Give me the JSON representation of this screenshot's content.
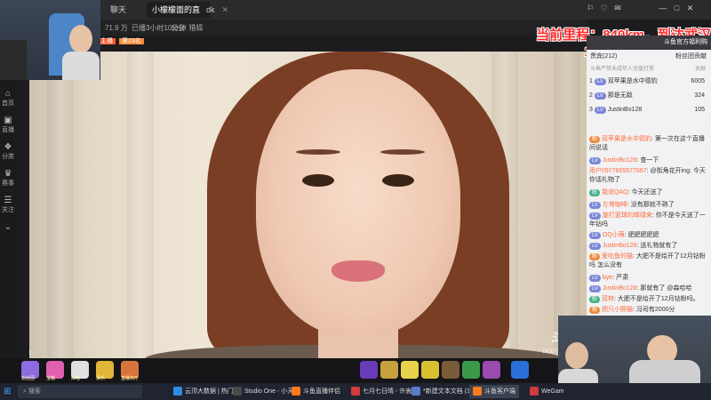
{
  "tabs": [
    {
      "label": "聊天"
    },
    {
      "label": "小檬檬面的直播间"
    },
    {
      "label": "dk"
    }
  ],
  "info": {
    "followers": "71.9 万",
    "duration": "已播3小时10分钟",
    "notice": "公会: 猎狐",
    "rank": "第23名",
    "tag": "主播"
  },
  "sidebar": [
    {
      "icon": "⌂",
      "label": "首页"
    },
    {
      "icon": "▣",
      "label": "直播"
    },
    {
      "icon": "❖",
      "label": "分类"
    },
    {
      "icon": "♛",
      "label": "赛事"
    },
    {
      "icon": "☰",
      "label": "关注"
    }
  ],
  "overlay": {
    "line1": "当前里程：840km，到达武汉",
    "line2": "10、11日双倍肥享值!"
  },
  "chat": {
    "header": "斗鱼官方福利购",
    "tab_label": "贵宾(212)",
    "tab_right": "粉丝团贡献",
    "subheader": "斗鱼严禁未成年人充值打赏",
    "rank_col": "贡献",
    "rank": [
      {
        "n": "1",
        "name": "双苹果是水中德豹",
        "val": "6005"
      },
      {
        "n": "2",
        "name": "那是无敌",
        "val": "324"
      },
      {
        "n": "3",
        "name": "JustinBo128",
        "val": "105"
      }
    ],
    "messages": [
      {
        "user": "双苹果是水中德豹",
        "text": "第一次在这个直播间说话"
      },
      {
        "user": "JustinBo128",
        "text": "查一下"
      },
      {
        "user": "用户0977855577667",
        "text": "@街角花开ing: 今天你话礼物了"
      },
      {
        "user": "我说QAQ",
        "text": "今天还送了"
      },
      {
        "user": "左塔咖啡",
        "text": "没有那就不熟了"
      },
      {
        "user": "旋打篮球的邮绿来",
        "text": "你不是今天送了一年钻吗"
      },
      {
        "user": "OQ小萌",
        "text": "肥肥肥肥肥"
      },
      {
        "user": "JustinBo128",
        "text": "送礼物就有了"
      },
      {
        "user": "爱吃鱼的猫",
        "text": "大肥不是给开了12月钻粉吗 怎么没有"
      },
      {
        "user": "bye",
        "text": "严肃"
      },
      {
        "user": "JustinBo128",
        "text": "那就有了 @森哈哈"
      },
      {
        "user": "双林",
        "text": "大肥不是给开了12月钻粉吗。"
      },
      {
        "user": "把只小野猫",
        "text": "冯司有2000分"
      }
    ]
  },
  "gifts": [
    {
      "label": "粉丝团"
    },
    {
      "label": "宝箱"
    },
    {
      "label": "红包"
    },
    {
      "label": "娱乐"
    },
    {
      "label": "直播天厅"
    }
  ],
  "video": {
    "watermark": "斗鱼",
    "watermark_sub": "DOUYU.COM",
    "corner_label": "斗鱼"
  },
  "taskbar": {
    "search": "搜索",
    "items": [
      {
        "label": "云顶大数据 | 热门...",
        "color": "#2f8de4"
      },
      {
        "label": "Studio One - 小天...",
        "color": "#4a4a4a"
      },
      {
        "label": "斗鱼直播伴侣",
        "color": "#ff7a1a"
      },
      {
        "label": "七月七日晴 - 许嵩版",
        "color": "#d23b3b"
      },
      {
        "label": "*新建文本文档 (3).t...",
        "color": "#5a7bc8"
      },
      {
        "label": "斗鱼客户端",
        "color": "#ff7a1a"
      },
      {
        "label": "WeGam",
        "color": "#d23b3b"
      }
    ]
  }
}
